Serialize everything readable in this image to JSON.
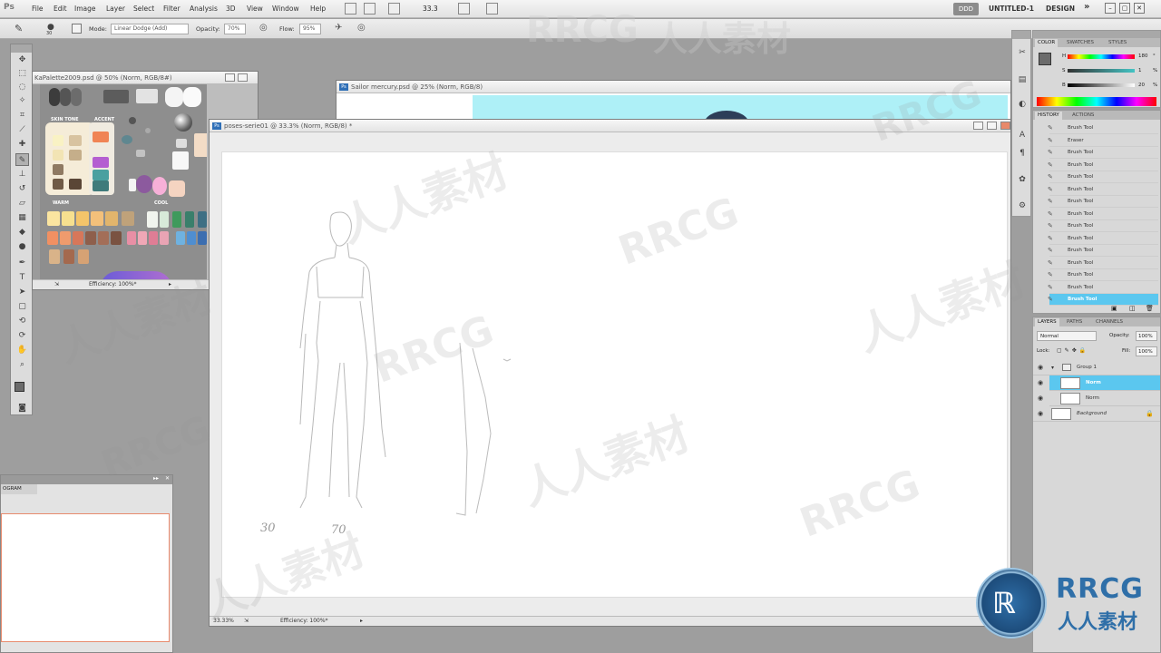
{
  "menubar": {
    "logo": "Ps",
    "items": [
      "File",
      "Edit",
      "Image",
      "Layer",
      "Select",
      "Filter",
      "Analysis",
      "3D",
      "View",
      "Window",
      "Help"
    ],
    "zoom": "33.3",
    "workspace_button": "DDD",
    "workspace_items": [
      "UNTITLED-1",
      "DESIGN"
    ],
    "more": "»"
  },
  "options": {
    "size": "30",
    "mode_label": "Mode:",
    "mode_value": "Linear Dodge (Add)",
    "opacity_label": "Opacity:",
    "opacity_value": "70%",
    "flow_label": "Flow:",
    "flow_value": "95%"
  },
  "palette_doc": {
    "title": "KaPalette2009.psd @ 50% (Norm, RGB/8#)",
    "status": "Efficiency: 100%*",
    "labels": {
      "skin": "SKIN TONE",
      "accent": "ACCENT",
      "warm": "WARM",
      "cool": "COOL"
    }
  },
  "sailor_doc": {
    "title": "Sailor mercury.psd @ 25% (Norm, RGB/8)"
  },
  "poses_doc": {
    "title": "poses-serie01 @ 33.3% (Norm, RGB/8) *",
    "status_zoom": "33.33%",
    "status": "Efficiency: 100%*",
    "sketch_labels": [
      "30",
      "70"
    ]
  },
  "histogram": {
    "tab": "OGRAM"
  },
  "color_panel": {
    "tabs": [
      "COLOR",
      "SWATCHES",
      "STYLES"
    ],
    "channels": [
      {
        "label": "H",
        "value": "180"
      },
      {
        "label": "S",
        "value": "1"
      },
      {
        "label": "B",
        "value": "20"
      }
    ],
    "units": [
      "°",
      "%",
      "%"
    ]
  },
  "history_panel": {
    "tabs": [
      "HISTORY",
      "ACTIONS"
    ],
    "items": [
      "Brush Tool",
      "Eraser",
      "Brush Tool",
      "Brush Tool",
      "Brush Tool",
      "Brush Tool",
      "Brush Tool",
      "Brush Tool",
      "Brush Tool",
      "Brush Tool",
      "Brush Tool",
      "Brush Tool",
      "Brush Tool",
      "Brush Tool",
      "Brush Tool"
    ],
    "selected_index": 14
  },
  "layers_panel": {
    "tabs": [
      "LAYERS",
      "PATHS",
      "CHANNELS"
    ],
    "blend_mode": "Normal",
    "opacity_label": "Opacity:",
    "opacity_value": "100%",
    "lock_label": "Lock:",
    "fill_label": "Fill:",
    "fill_value": "100%",
    "layers": [
      "Group 1",
      "Norm",
      "Norm",
      "Background"
    ],
    "selected_index": 1
  },
  "watermark": {
    "latin": "RRCG",
    "cjk": "人人素材",
    "logo_top": "RRCG",
    "logo_bottom": "人人素材"
  },
  "colors": {
    "selection": "#5bc7ef",
    "ps_blue": "#2f6fb7",
    "foreground": "#6b6b6b",
    "background": "#c49a72"
  }
}
